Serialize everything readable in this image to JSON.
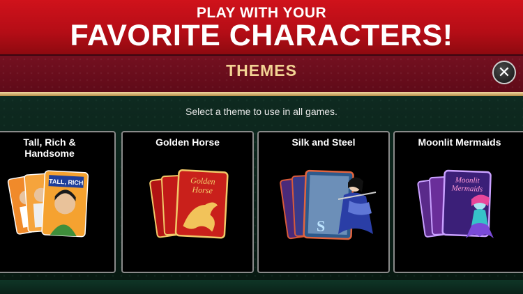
{
  "banner": {
    "line1": "PLAY WITH YOUR",
    "line2": "FAVORITE CHARACTERS!"
  },
  "dialog": {
    "title": "THEMES",
    "close_icon": "close-icon",
    "subtitle": "Select a theme to use in all games."
  },
  "themes": [
    {
      "name": "Tall, Rich & Handsome",
      "line1": "Tall, Rich &",
      "line2": "Handsome"
    },
    {
      "name": "Golden Horse"
    },
    {
      "name": "Silk and Steel"
    },
    {
      "name": "Moonlit Mermaids"
    }
  ],
  "card_text": {
    "trh_card": "TALL, RICH",
    "golden_card_line1": "Golden",
    "golden_card_line2": "Horse",
    "silk_card": "S",
    "mermaid_card_line1": "Moonlit",
    "mermaid_card_line2": "Mermaids"
  },
  "colors": {
    "banner_red": "#c4101a",
    "header_maroon": "#6a0e1c",
    "title_gold": "#f3d394",
    "panel_green": "#0e2a20"
  }
}
